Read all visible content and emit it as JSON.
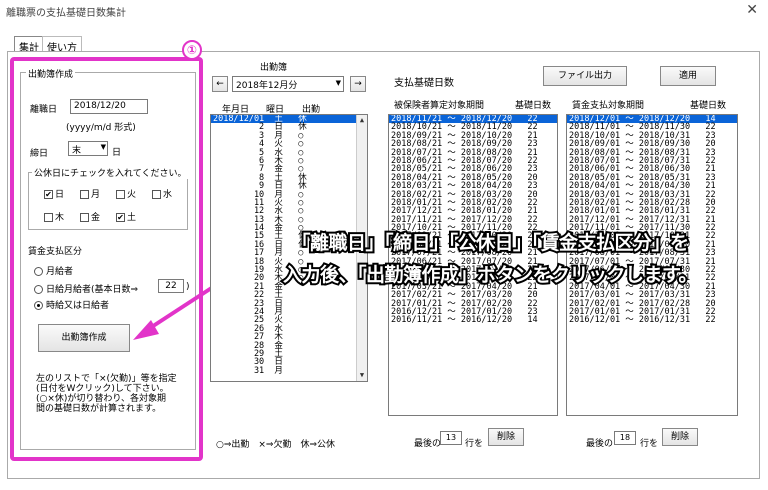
{
  "window": {
    "title": "離職票の支払基礎日数集計",
    "close_icon": "close-icon"
  },
  "tabs": [
    {
      "label": "集計"
    },
    {
      "label": "使い方"
    }
  ],
  "callout": {
    "number": "①"
  },
  "left_panel": {
    "group_title": "出勤簿作成",
    "rishoku_label": "離職日",
    "rishoku_value": "2018/12/20",
    "format_hint": "(yyyy/m/d 形式)",
    "shime_label": "締日",
    "shime_value": "末",
    "shime_suffix": "日",
    "holiday_group_title": "公休日にチェックを入れてください。",
    "holidays": [
      {
        "label": "日",
        "checked": "✔"
      },
      {
        "label": "月",
        "checked": ""
      },
      {
        "label": "火",
        "checked": ""
      },
      {
        "label": "水",
        "checked": ""
      },
      {
        "label": "木",
        "checked": ""
      },
      {
        "label": "金",
        "checked": ""
      },
      {
        "label": "土",
        "checked": "✔"
      }
    ],
    "wage_group_title": "賃金支払区分",
    "wage_options": [
      {
        "label": "月給者"
      },
      {
        "label": "日給月給者(基本日数⇒"
      },
      {
        "label": "時給又は日給者"
      }
    ],
    "base_days_value": "22",
    "base_days_suffix": ")",
    "make_button": "出勤簿作成",
    "note": "左のリストで「×(欠勤)」等を指定\n(日付をWクリック)して下さい。\n(○×休)が切り替わり、各対象期\n間の基礎日数が計算されます。"
  },
  "attendance": {
    "title": "出勤簿",
    "prev_button": "←",
    "next_button": "→",
    "month_value": "2018年12月分",
    "col_date": "年月日",
    "col_weekday": "曜日",
    "col_attend": "出勤",
    "rows": [
      "2018/12/01  土   休",
      "         2  日   休",
      "         3  月   ○",
      "         4  火   ○",
      "         5  水   ○",
      "         6  木   ○",
      "         7  金   ○",
      "         8  土   休",
      "         9  日   休",
      "        10  月   ○",
      "        11  火   ○",
      "        12  水   ○",
      "        13  木   ○",
      "        14  金   ○",
      "        15  土   休",
      "        16  日   休",
      "        17  月   ○",
      "        18  火   ○",
      "        19  水   ○",
      "        20  木   ○",
      "        21  金",
      "        22  土",
      "        23  日",
      "        24  月",
      "        25  火",
      "        26  水",
      "        27  木",
      "        28  金",
      "        29  土",
      "        30  日",
      "        31  月"
    ],
    "legend": "○⇒出勤　×⇒欠勤　休⇒公休"
  },
  "header_right": {
    "base_days_label": "支払基礎日数",
    "file_button": "ファイル出力",
    "apply_button": "適用"
  },
  "insured_list": {
    "col_period": "被保険者算定対象期間",
    "col_days": "基礎日数",
    "rows": [
      "2018/11/21 ～ 2018/12/20   22",
      "2018/10/21 ～ 2018/11/20   22",
      "2018/09/21 ～ 2018/10/20   21",
      "2018/08/21 ～ 2018/09/20   23",
      "2018/07/21 ～ 2018/08/20   21",
      "2018/06/21 ～ 2018/07/20   22",
      "2018/05/21 ～ 2018/06/20   23",
      "2018/04/21 ～ 2018/05/20   20",
      "2018/03/21 ～ 2018/04/20   23",
      "2018/02/21 ～ 2018/03/20   20",
      "2018/01/21 ～ 2018/02/20   22",
      "2017/12/21 ～ 2018/01/20   21",
      "2017/11/21 ～ 2017/12/20   22",
      "2017/10/21 ～ 2017/11/20   22",
      "2017/09/21 ～ 2017/10/20   21",
      "2017/08/21 ～ 2017/09/20   23",
      "2017/07/21 ～ 2017/08/20   21",
      "2017/06/21 ～ 2017/07/20   21",
      "2017/05/21 ～ 2017/06/20   22",
      "2017/04/21 ～ 2017/05/20   22",
      "2017/03/21 ～ 2017/04/20   21",
      "2017/02/21 ～ 2017/03/20   20",
      "2017/01/21 ～ 2017/02/20   22",
      "2016/12/21 ～ 2017/01/20   23",
      "2016/11/21 ～ 2016/12/20   14"
    ],
    "last_label": "最後の",
    "last_value": "13",
    "last_suffix": "行を",
    "delete_button": "削除"
  },
  "wage_list": {
    "col_period": "賃金支払対象期間",
    "col_days": "基礎日数",
    "rows": [
      "2018/12/01 ～ 2018/12/20   14",
      "2018/11/01 ～ 2018/11/30   22",
      "2018/10/01 ～ 2018/10/31   23",
      "2018/09/01 ～ 2018/09/30   20",
      "2018/08/01 ～ 2018/08/31   23",
      "2018/07/01 ～ 2018/07/31   22",
      "2018/06/01 ～ 2018/06/30   21",
      "2018/05/01 ～ 2018/05/31   23",
      "2018/04/01 ～ 2018/04/30   21",
      "2018/03/01 ～ 2018/03/31   22",
      "2018/02/01 ～ 2018/02/28   20",
      "2018/01/01 ～ 2018/01/31   22",
      "2017/12/01 ～ 2017/12/31   21",
      "2017/11/01 ～ 2017/11/30   22",
      "2017/10/01 ～ 2017/10/31   22",
      "2017/09/01 ～ 2017/09/30   21",
      "2017/08/01 ～ 2017/08/31   23",
      "2017/07/01 ～ 2017/07/31   21",
      "2017/06/01 ～ 2017/06/30   22",
      "2017/05/01 ～ 2017/05/31   22",
      "2017/04/01 ～ 2017/04/30   21",
      "2017/03/01 ～ 2017/03/31   23",
      "2017/02/01 ～ 2017/02/28   20",
      "2017/01/01 ～ 2017/01/31   22",
      "2016/12/01 ～ 2016/12/31   22"
    ],
    "last_label": "最後の",
    "last_value": "18",
    "last_suffix": "行を",
    "delete_button": "削除"
  },
  "overlay": {
    "line1": "「離職日」「締日」「公休日」「賃金支払区分」を",
    "line2": "入力後、「出勤簿作成」ボタンをクリックします。"
  },
  "colors": {
    "accent": "#e234c9",
    "selection": "#0a64d8"
  }
}
